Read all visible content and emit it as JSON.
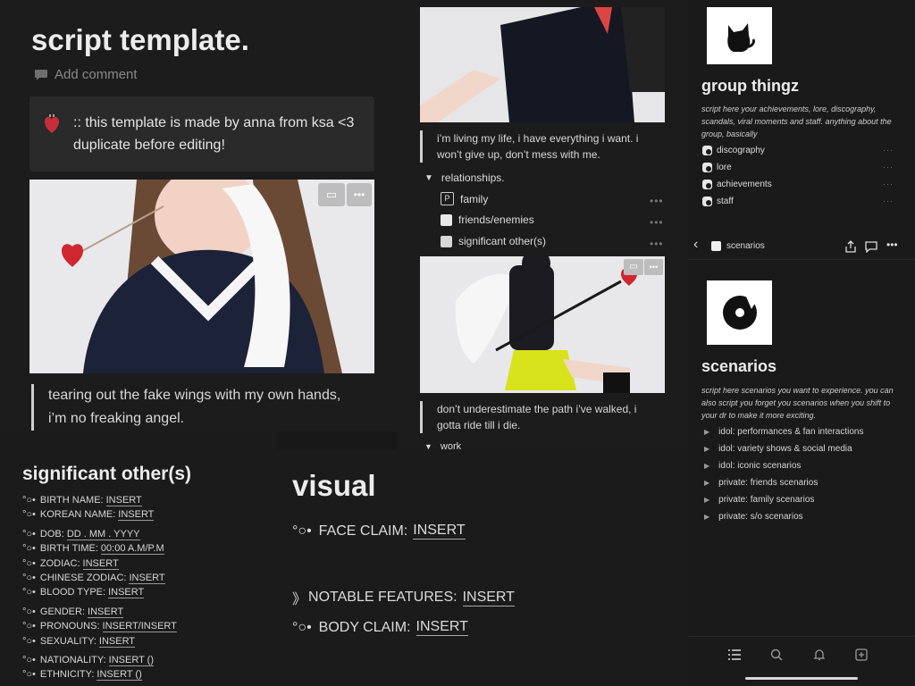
{
  "main": {
    "title": "script template.",
    "add_comment": "Add comment",
    "callout_icon": "anatomical-heart",
    "callout_text": ":: this template is made by anna from ksa <3 duplicate before editing!",
    "quote": "tearing out the fake wings with my own hands, i’m no freaking angel."
  },
  "middle": {
    "quote1": "i’m living my life, i have everything i want. i won’t give up, don’t mess with me.",
    "toggle_label": "relationships.",
    "items": [
      {
        "label": "family",
        "icon": "puzzle-icon"
      },
      {
        "label": "friends/enemies",
        "icon": "bookmark-icon"
      },
      {
        "label": "significant other(s)",
        "icon": "people-icon"
      }
    ],
    "more_dots": "•••",
    "quote2": "don’t underestimate the path i’ve walked, i gotta ride till i die.",
    "cut_label": "work"
  },
  "group": {
    "title": "group thingz",
    "description": "script here your achievements, lore, discography, scandals, viral moments and staff. anything about the group, basically",
    "items": [
      "discography",
      "lore",
      "achievements",
      "staff"
    ]
  },
  "scenarios": {
    "header_title": "scenarios",
    "title": "scenarios",
    "description": "script here scenarios you want to experience. you can also script you forget you scenarios when you shift to your dr to make it more exciting.",
    "items": [
      "idol: performances & fan interactions",
      "idol: variety shows & social media",
      "idol: iconic scenarios",
      "private: friends scenarios",
      "private: family scenarios",
      "private: s/o scenarios"
    ]
  },
  "significant_other": {
    "title": "significant other(s)",
    "prefix": "°○•",
    "groups": [
      [
        {
          "label": "BIRTH NAME:",
          "value": "INSERT"
        },
        {
          "label": "KOREAN NAME:",
          "value": "INSERT"
        }
      ],
      [
        {
          "label": "DOB:",
          "value": "DD . MM . YYYY"
        },
        {
          "label": "BIRTH TIME:",
          "value": "00:00 A.M/P.M"
        },
        {
          "label": "ZODIAC:",
          "value": "INSERT"
        },
        {
          "label": "CHINESE ZODIAC:",
          "value": "INSERT"
        },
        {
          "label": "BLOOD TYPE:",
          "value": "INSERT"
        }
      ],
      [
        {
          "label": "GENDER:",
          "value": "INSERT"
        },
        {
          "label": "PRONOUNS:",
          "value": "INSERT/INSERT"
        },
        {
          "label": "SEXUALITY:",
          "value": "INSERT"
        }
      ],
      [
        {
          "label": "NATIONALITY:",
          "value": "INSERT ()"
        },
        {
          "label": "ETHNICITY:",
          "value": "INSERT ()"
        }
      ]
    ]
  },
  "visual": {
    "title": "visual",
    "face_prefix": "°○•",
    "face_label": "FACE CLAIM:",
    "face_value": "INSERT",
    "notable_prefix": "》",
    "notable_label": "NOTABLE FEATURES:",
    "notable_value": "INSERT",
    "body_prefix": "°○•",
    "body_label": "BODY CLAIM:",
    "body_value": "INSERT"
  },
  "colors": {
    "background": "#1c1c1c",
    "callout": "#2a2a2a",
    "text": "#e6e6e6",
    "heart": "#c62e3a"
  }
}
